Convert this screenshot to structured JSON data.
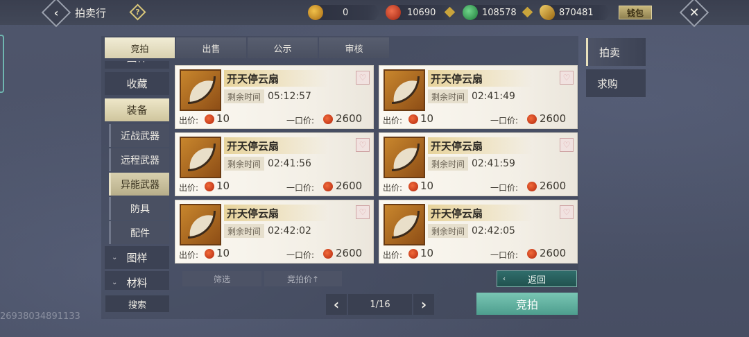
{
  "header": {
    "title": "拍卖行",
    "back_icon": "chevron-left-icon",
    "help_icon": "question-icon",
    "close_icon": "close-icon",
    "wallet_label": "钱包"
  },
  "currencies": [
    {
      "icon": "gold-pouch-icon",
      "value": "0",
      "color": "#d79a2a"
    },
    {
      "icon": "red-jade-icon",
      "value": "10690",
      "color": "#c9442c"
    },
    {
      "icon": "green-jade-icon",
      "value": "108578",
      "color": "#3a9e52"
    },
    {
      "icon": "gold-ingot-icon",
      "value": "870481",
      "color": "#c58a22"
    }
  ],
  "tabs": [
    {
      "label": "竞拍",
      "active": true
    },
    {
      "label": "出售",
      "active": false
    },
    {
      "label": "公示",
      "active": false
    },
    {
      "label": "审核",
      "active": false
    }
  ],
  "categories": {
    "partial_top": "图样",
    "favorites": "收藏",
    "equipment": "装备",
    "subs": [
      "近战武器",
      "远程武器",
      "异能武器",
      "防具",
      "配件"
    ],
    "active_sub": "异能武器",
    "patterns": "图样",
    "materials": "材料"
  },
  "items": [
    {
      "name": "开天停云扇",
      "time_label": "剩余时间",
      "time": "05:12:57",
      "bid_label": "出价:",
      "bid": "10",
      "buy_label": "一口价:",
      "buy": "2600"
    },
    {
      "name": "开天停云扇",
      "time_label": "剩余时间",
      "time": "02:41:49",
      "bid_label": "出价:",
      "bid": "10",
      "buy_label": "一口价:",
      "buy": "2600"
    },
    {
      "name": "开天停云扇",
      "time_label": "剩余时间",
      "time": "02:41:56",
      "bid_label": "出价:",
      "bid": "10",
      "buy_label": "一口价:",
      "buy": "2600"
    },
    {
      "name": "开天停云扇",
      "time_label": "剩余时间",
      "time": "02:41:59",
      "bid_label": "出价:",
      "bid": "10",
      "buy_label": "一口价:",
      "buy": "2600"
    },
    {
      "name": "开天停云扇",
      "time_label": "剩余时间",
      "time": "02:42:02",
      "bid_label": "出价:",
      "bid": "10",
      "buy_label": "一口价:",
      "buy": "2600"
    },
    {
      "name": "开天停云扇",
      "time_label": "剩余时间",
      "time": "02:42:05",
      "bid_label": "出价:",
      "bid": "10",
      "buy_label": "一口价:",
      "buy": "2600"
    }
  ],
  "filter": {
    "filter_label": "筛选",
    "sort_label": "竞拍价↑",
    "return_label": "返回"
  },
  "search_label": "搜索",
  "pager": {
    "text": "1/16"
  },
  "bid_button": "竞拍",
  "side_tabs": [
    {
      "label": "拍卖",
      "active": true
    },
    {
      "label": "求购",
      "active": false
    }
  ],
  "user_id": "26938034891133"
}
